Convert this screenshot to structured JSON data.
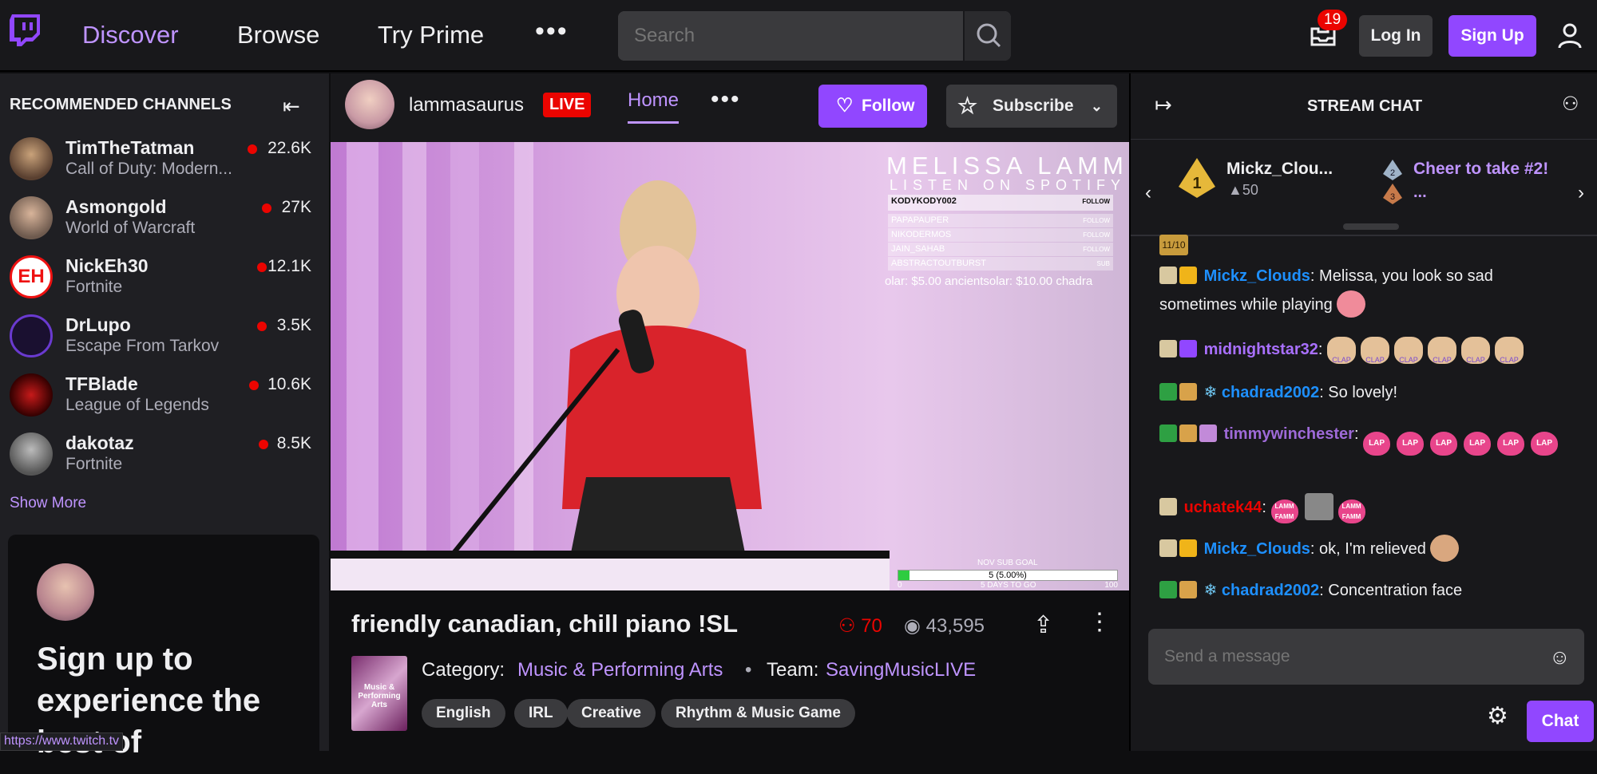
{
  "topbar": {
    "nav": [
      "Discover",
      "Browse",
      "Try Prime"
    ],
    "more": "•••",
    "search_placeholder": "Search",
    "inbox_count": "19",
    "login_label": "Log In",
    "signup_label": "Sign Up"
  },
  "sidebar": {
    "title": "RECOMMENDED CHANNELS",
    "channels": [
      {
        "name": "TimTheTatman",
        "game": "Call of Duty: Modern...",
        "viewers": "22.6K"
      },
      {
        "name": "Asmongold",
        "game": "World of Warcraft",
        "viewers": "27K"
      },
      {
        "name": "NickEh30",
        "game": "Fortnite",
        "viewers": "12.1K"
      },
      {
        "name": "DrLupo",
        "game": "Escape From Tarkov",
        "viewers": "3.5K"
      },
      {
        "name": "TFBlade",
        "game": "League of Legends",
        "viewers": "10.6K"
      },
      {
        "name": "dakotaz",
        "game": "Fortnite",
        "viewers": "8.5K"
      }
    ],
    "show_more": "Show More",
    "card_text": "Sign up to experience the best of"
  },
  "status_url": "https://www.twitch.tv",
  "stream": {
    "channel_name": "lammasaurus",
    "live_label": "LIVE",
    "tab_home": "Home",
    "more": "•••",
    "follow_label": "Follow",
    "subscribe_label": "Subscribe",
    "title": "friendly canadian, chill piano !SL",
    "viewers": "70",
    "views": "43,595",
    "category_label": "Category:",
    "category": "Music & Performing Arts",
    "category_art_text": "Music & Performing Arts",
    "separator": "•",
    "team_label": "Team:",
    "team": "SavingMusicLIVE",
    "tags": [
      "English",
      "IRL",
      "Creative",
      "Rhythm & Music Game"
    ]
  },
  "video_overlay": {
    "title": "MELISSA LAMM",
    "subtitle": "LISTEN ON SPOTIFY",
    "followers": [
      {
        "name": "KODYKODY002",
        "tag": "FOLLOW"
      },
      {
        "name": "PAPAPAUPER",
        "tag": "FOLLOW"
      },
      {
        "name": "NIKODERMOS",
        "tag": "FOLLOW"
      },
      {
        "name": "JAIN_SAHAB",
        "tag": "FOLLOW"
      },
      {
        "name": "ABSTRACTOUTBURST",
        "tag": "SUB"
      }
    ],
    "ticker": "olar: $5.00    ancientsolar: $10.00    chadra",
    "goal_label": "NOV SUB GOAL",
    "goal_value": "5 (5.00%)",
    "goal_days": "5 DAYS TO GO",
    "goal_min": "0",
    "goal_max": "100",
    "goal_progress": 0.05
  },
  "chat": {
    "title": "STREAM CHAT",
    "leader_name": "Mickz_Clou...",
    "leader_score": "▲50",
    "cheer_text": "Cheer to take #2!",
    "cheer_more": "...",
    "rank_2": "2",
    "rank_3": "3",
    "top_badge": "11/10",
    "messages": [
      {
        "user": "Mickz_Clouds",
        "color": "#1e90ff",
        "text": ": Melissa, you look so sad sometimes while playing"
      },
      {
        "user": "midnightstar32",
        "color": "#a970ff",
        "text": ":"
      },
      {
        "user": "chadrad2002",
        "color": "#1e90ff",
        "text": ": So lovely!"
      },
      {
        "user": "timmywinchester",
        "color": "#9e6ad8",
        "text": ":"
      },
      {
        "user": "uchatek44",
        "color": "#eb0400",
        "text": ":"
      },
      {
        "user": "Mickz_Clouds",
        "color": "#1e90ff",
        "text": ": ok, I'm relieved"
      },
      {
        "user": "chadrad2002",
        "color": "#1e90ff",
        "text": ": Concentration face"
      }
    ],
    "clap_emote": "CLAP",
    "heart_emote": "LAP",
    "lamm_emote": "LAMM FAMM",
    "input_placeholder": "Send a message",
    "chat_button": "Chat"
  },
  "colors": {
    "accent": "#9147ff",
    "accent_text": "#bf94ff",
    "live": "#eb0400"
  }
}
